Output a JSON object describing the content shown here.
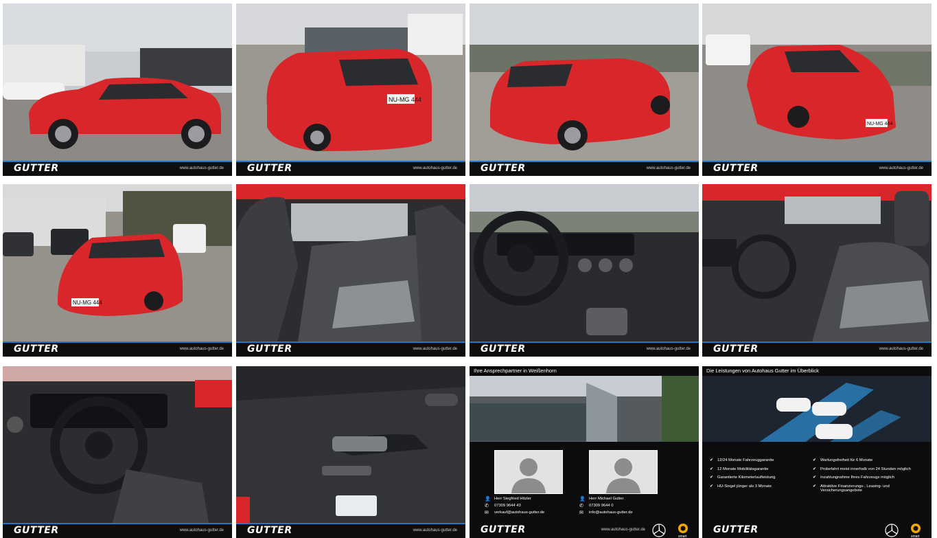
{
  "brand": {
    "logo": "GUTTER",
    "url": "www.autohaus-gutter.de"
  },
  "photos": [
    {
      "name": "car-side-left",
      "plate": ""
    },
    {
      "name": "car-rear-left",
      "plate": "NU-MG 444"
    },
    {
      "name": "car-rear-right",
      "plate": ""
    },
    {
      "name": "car-front-right",
      "plate": "NU-MG 444"
    },
    {
      "name": "car-front-left",
      "plate": "NU-MG 444"
    },
    {
      "name": "rear-seats",
      "plate": ""
    },
    {
      "name": "dashboard",
      "plate": ""
    },
    {
      "name": "front-seats",
      "plate": ""
    },
    {
      "name": "cockpit",
      "plate": ""
    },
    {
      "name": "door-panel",
      "plate": ""
    }
  ],
  "contact_tile": {
    "heading": "Ihre Ansprechpartner in Weißenhorn",
    "contacts": [
      {
        "name": "Herr Siegfried Hitzler",
        "phone": "07309 9644 43",
        "email": "verkauf@autohaus-gutter.de"
      },
      {
        "name": "Herr Michael Gutter",
        "phone": "07309 9644 0",
        "email": "info@autohaus-gutter.de"
      }
    ],
    "smart_label": "smart"
  },
  "services_tile": {
    "heading": "Die Leistungen von Autohaus Gutter im Überblick",
    "left": [
      "12/24 Monate Fahrzeuggarantie",
      "12 Monate Mobilitätsgarantie",
      "Garantierte Kilometerlaufleistung",
      "HU-Siegel jünger als 3 Monate"
    ],
    "right": [
      "Wartungsfreiheit für 6 Monate",
      "Probefahrt meist innerhalb von 24 Stunden möglich",
      "Inzahlungnahme Ihres Fahrzeugs möglich",
      "Attraktive Finanzierungs-, Leasing- und Versicherungsangebote"
    ],
    "smart_label": "smart"
  },
  "colors": {
    "car_red": "#d9262b",
    "accent_blue": "#1f77d0",
    "bar_dark": "#0e0e10"
  }
}
